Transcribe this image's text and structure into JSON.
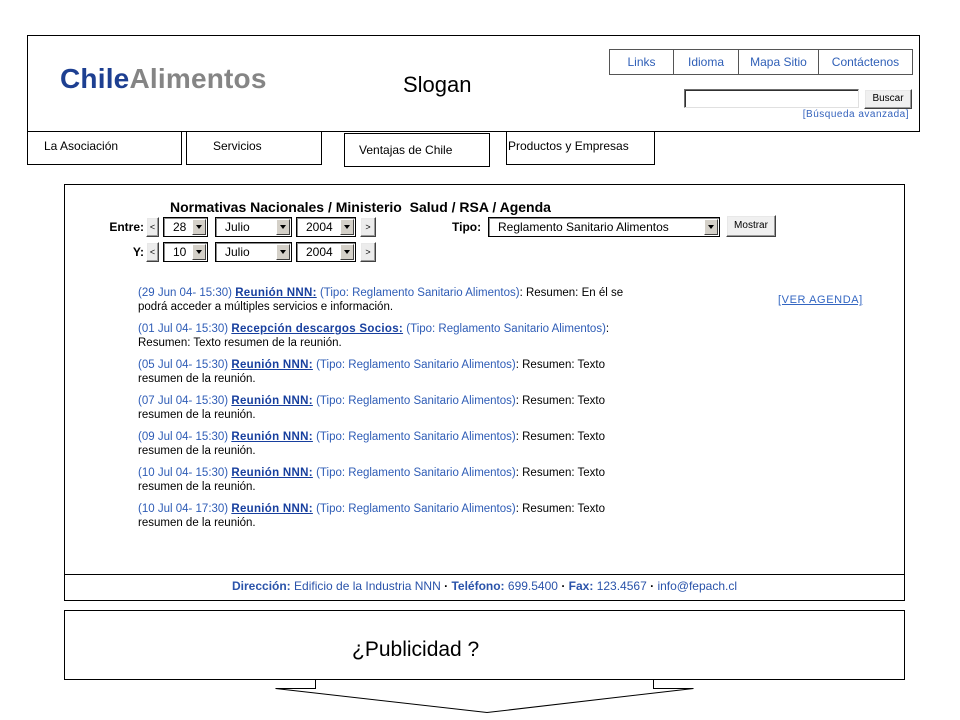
{
  "logo": {
    "primary": "Chile",
    "secondary": "Alimentos"
  },
  "slogan": "Slogan",
  "top_nav": [
    {
      "label": "Links"
    },
    {
      "label": "Idioma"
    },
    {
      "label": "Mapa Sitio"
    },
    {
      "label": "Contáctenos"
    }
  ],
  "search": {
    "value": "",
    "button_label": "Buscar",
    "advanced_link": "[Búsqueda avanzada]"
  },
  "tabs": [
    {
      "label": "La Asociación"
    },
    {
      "label": "Servicios"
    },
    {
      "label": "Ventajas de Chile"
    },
    {
      "label": "Productos y Empresas"
    }
  ],
  "agenda": {
    "title": "Normativas Nacionales / Ministerio  Salud / RSA / Agenda",
    "filters": {
      "prev_label": "<",
      "next_label": ">",
      "from": {
        "label": "Entre:",
        "day": "28",
        "month": "Julio",
        "year": "2004"
      },
      "to": {
        "label": "Y:",
        "day": "10",
        "month": "Julio",
        "year": "2004"
      },
      "type": {
        "label": "Tipo:",
        "value": "Reglamento Sanitario Alimentos"
      },
      "submit_label": "Mostrar"
    },
    "view_all_link": "[VER AGENDA]",
    "events": [
      {
        "date": "(29 Jun 04- 15:30)",
        "title": "Reunión NNN:",
        "type": "(Tipo: Reglamento Sanitario Alimentos)",
        "summary": ": Resumen: En él se podrá acceder a múltiples servicios e información."
      },
      {
        "date": "(01 Jul 04- 15:30)",
        "title": "Recepción descargos Socios:",
        "type": "(Tipo: Reglamento Sanitario Alimentos)",
        "summary": ": Resumen: Texto resumen de la reunión."
      },
      {
        "date": "(05 Jul 04- 15:30)",
        "title": "Reunión NNN:",
        "type": "(Tipo: Reglamento Sanitario Alimentos)",
        "summary": ": Resumen: Texto resumen de la reunión."
      },
      {
        "date": "(07 Jul 04- 15:30)",
        "title": "Reunión NNN:",
        "type": "(Tipo: Reglamento Sanitario Alimentos)",
        "summary": ": Resumen: Texto resumen de la reunión."
      },
      {
        "date": "(09 Jul 04- 15:30)",
        "title": "Reunión NNN:",
        "type": "(Tipo: Reglamento Sanitario Alimentos)",
        "summary": ": Resumen: Texto resumen de la reunión."
      },
      {
        "date": "(10 Jul 04- 15:30)",
        "title": "Reunión NNN:",
        "type": "(Tipo: Reglamento Sanitario Alimentos)",
        "summary": ": Resumen: Texto resumen de la reunión."
      },
      {
        "date": "(10 Jul 04- 17:30)",
        "title": "Reunión NNN:",
        "type": "(Tipo: Reglamento Sanitario Alimentos)",
        "summary": ": Resumen: Texto resumen de la reunión."
      }
    ]
  },
  "footer": {
    "address_label": "Dirección:",
    "address": "Edificio de la Industria NNN",
    "phone_label": "Teléfono:",
    "phone": "699.5400",
    "fax_label": "Fax:",
    "fax": "123.4567",
    "email": "info@fepach.cl",
    "separator": "·"
  },
  "ad": {
    "text": "¿Publicidad ?"
  },
  "icons": {
    "select_dropdown": "chevron-down-icon",
    "bottom_arrow": "down-arrow-shape"
  },
  "colors": {
    "logo_primary": "#1d3f91",
    "logo_secondary": "#858585",
    "link": "#173f9e",
    "info_text": "#2e5cb6",
    "footer_text": "#2a53aa"
  }
}
